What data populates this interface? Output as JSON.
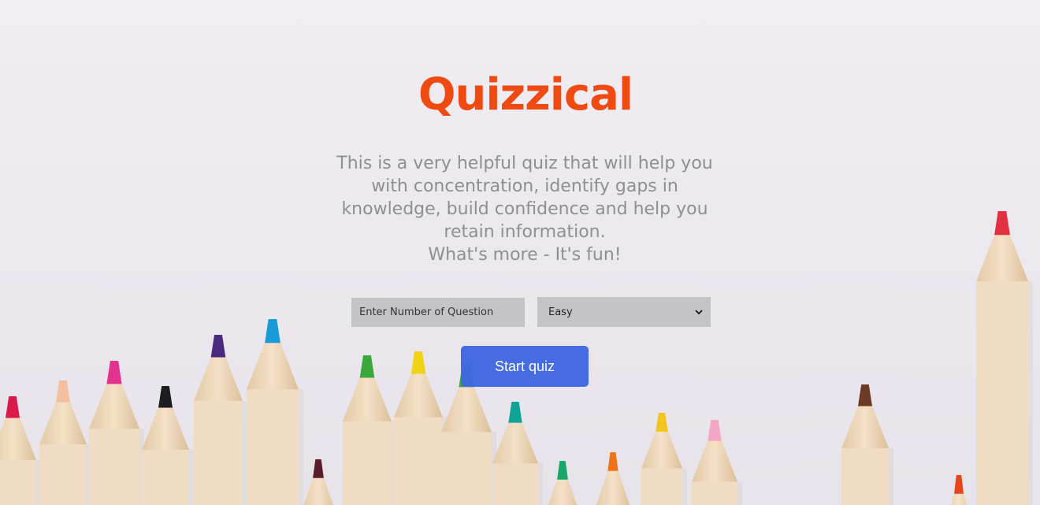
{
  "app": {
    "title": "Quizzical",
    "description_lines": [
      "This is a very helpful quiz that will help you",
      "with concentration, identify gaps in",
      "knowledge, build confidence and help you",
      "retain information.",
      "What's more - It's fun!"
    ]
  },
  "form": {
    "number_input": {
      "value": "",
      "placeholder": "Enter Number of Question"
    },
    "difficulty_select": {
      "selected": "Easy",
      "icon": "chevron-down-icon"
    },
    "start_label": "Start quiz"
  },
  "colors": {
    "title": "#f04a12",
    "description": "#8f8f8f",
    "button": "#4169e1",
    "field_bg": "#c4c3c6",
    "background": "#ebe8ee"
  }
}
